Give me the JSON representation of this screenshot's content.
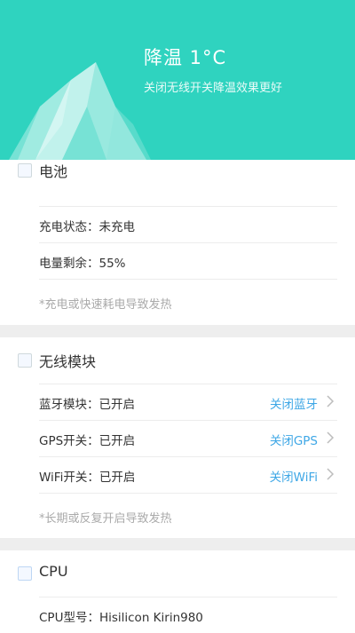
{
  "header": {
    "title": "降温 1°C",
    "subtitle": "关闭无线开关降温效果更好",
    "colors": {
      "background": "#2fd3bf"
    }
  },
  "battery": {
    "title": "电池",
    "icon": "battery-icon",
    "rows": [
      {
        "text": "充电状态：未充电"
      },
      {
        "text": "电量剩余：55%"
      }
    ],
    "note": "*充电或快速耗电导致发热"
  },
  "wireless": {
    "title": "无线模块",
    "icon": "wireless-icon",
    "rows": [
      {
        "text": "蓝牙模块：已开启",
        "action": "关闭蓝牙"
      },
      {
        "text": "GPS开关：已开启",
        "action": "关闭GPS"
      },
      {
        "text": "WiFi开关：已开启",
        "action": "关闭WiFi"
      }
    ],
    "note": "*长期或反复开启导致发热",
    "accent": "#3ea7e6"
  },
  "cpu": {
    "title": "CPU",
    "icon": "cpu-icon",
    "rows": [
      {
        "text": "CPU型号：Hisilicon Kirin980"
      }
    ]
  }
}
